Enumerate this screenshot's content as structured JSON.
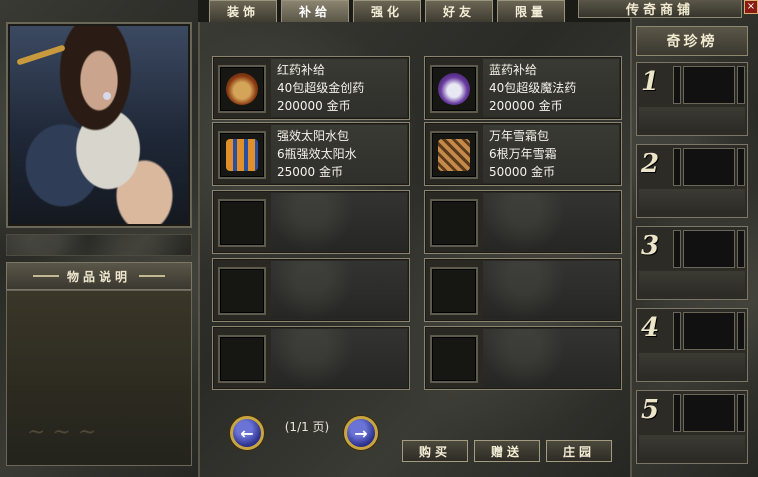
{
  "tabs": [
    "装饰",
    "补给",
    "强化",
    "好友",
    "限量"
  ],
  "active_tab_index": 1,
  "shop_title": "传奇商铺",
  "close_label": "×",
  "description": {
    "header": "物品说明"
  },
  "items": [
    {
      "name": "红药补给",
      "desc": "40包超级金创药",
      "price": "200000 金币",
      "icon": "red-potion-bag-icon"
    },
    {
      "name": "蓝药补给",
      "desc": "40包超级魔法药",
      "price": "200000 金币",
      "icon": "blue-potion-bag-icon"
    },
    {
      "name": "强效太阳水包",
      "desc": "6瓶强效太阳水",
      "price": "25000 金币",
      "icon": "sun-water-icon"
    },
    {
      "name": "万年雪霜包",
      "desc": "6根万年雪霜",
      "price": "50000 金币",
      "icon": "snow-frost-icon"
    },
    {
      "name": "",
      "desc": "",
      "price": ""
    },
    {
      "name": "",
      "desc": "",
      "price": ""
    },
    {
      "name": "",
      "desc": "",
      "price": ""
    },
    {
      "name": "",
      "desc": "",
      "price": ""
    },
    {
      "name": "",
      "desc": "",
      "price": ""
    },
    {
      "name": "",
      "desc": "",
      "price": ""
    }
  ],
  "pagination": {
    "text": "(1/1 页)",
    "prev_icon": "arrow-left-icon",
    "next_icon": "arrow-right-icon"
  },
  "actions": {
    "buy": "购买",
    "gift": "赠送",
    "manor": "庄园"
  },
  "ranking": {
    "title": "奇珍榜",
    "ranks": [
      "1",
      "2",
      "3",
      "4",
      "5"
    ]
  },
  "colors": {
    "frame": "#8a8470",
    "gold": "#c9a53f",
    "nav_blue": "#2a2f8a"
  }
}
